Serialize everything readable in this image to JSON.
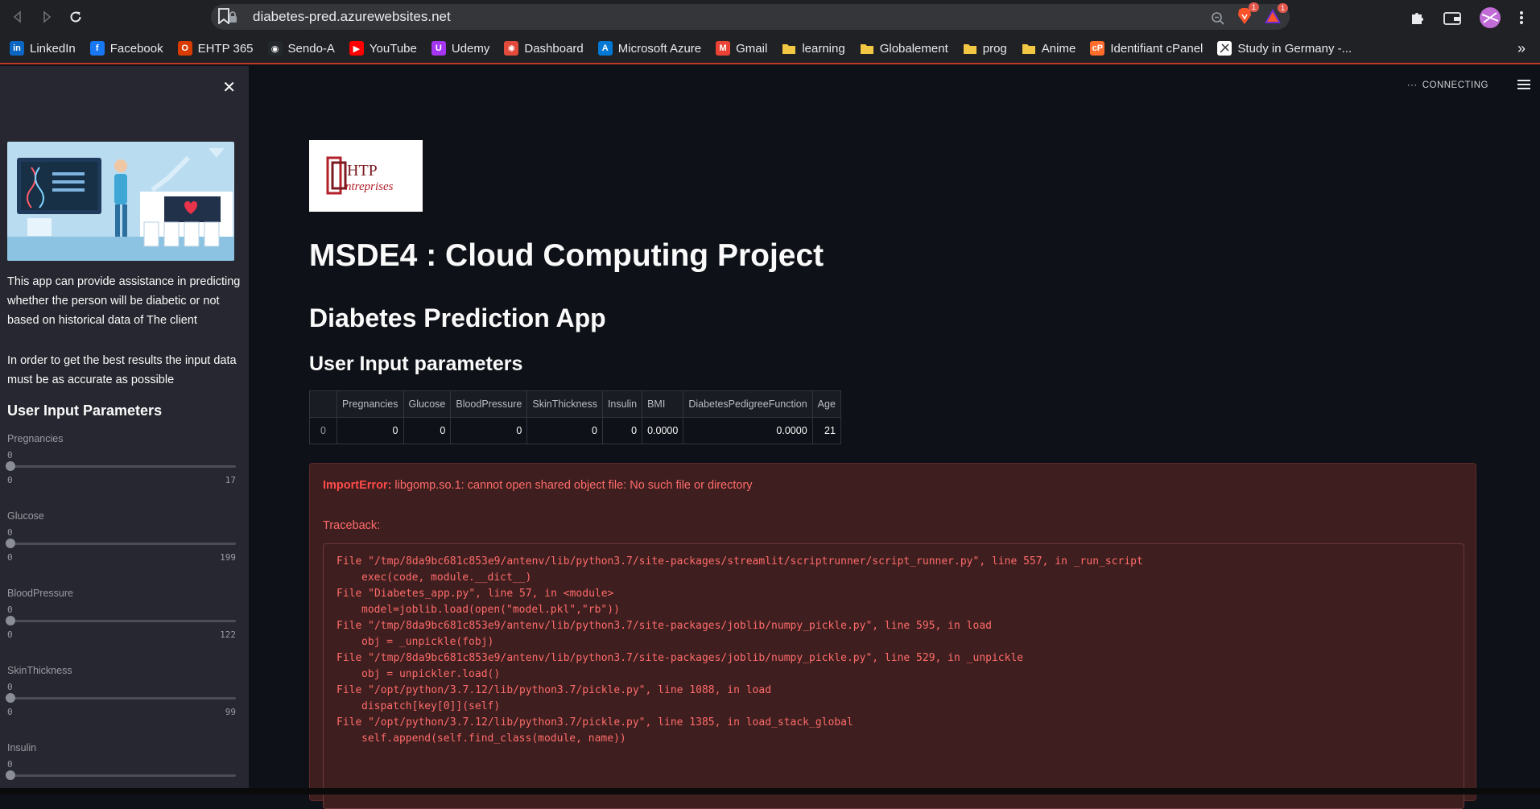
{
  "browser": {
    "url": "diabetes-pred.azurewebsites.net",
    "extension_badges": [
      "1",
      "1"
    ]
  },
  "bookmarks": [
    {
      "label": "LinkedIn",
      "icon": "linkedin-icon",
      "color": "#0a66c2",
      "glyph": "in"
    },
    {
      "label": "Facebook",
      "icon": "facebook-icon",
      "color": "#1877f2",
      "glyph": "f"
    },
    {
      "label": "EHTP 365",
      "icon": "office-icon",
      "color": "#d83b01",
      "glyph": "O"
    },
    {
      "label": "Sendo-A",
      "icon": "github-icon",
      "color": "#24292e",
      "glyph": "◉"
    },
    {
      "label": "YouTube",
      "icon": "youtube-icon",
      "color": "#ff0000",
      "glyph": "▶"
    },
    {
      "label": "Udemy",
      "icon": "udemy-icon",
      "color": "#a435f0",
      "glyph": "U"
    },
    {
      "label": "Dashboard",
      "icon": "dashboard-icon",
      "color": "#e24b3b",
      "glyph": "✺"
    },
    {
      "label": "Microsoft Azure",
      "icon": "azure-icon",
      "color": "#0078d4",
      "glyph": "A"
    },
    {
      "label": "Gmail",
      "icon": "gmail-icon",
      "color": "#ea4335",
      "glyph": "M"
    },
    {
      "label": "learning",
      "icon": "folder-icon",
      "color": "#f2c744",
      "glyph": ""
    },
    {
      "label": "Globalement",
      "icon": "folder-icon",
      "color": "#f2c744",
      "glyph": ""
    },
    {
      "label": "prog",
      "icon": "folder-icon",
      "color": "#f2c744",
      "glyph": ""
    },
    {
      "label": "Anime",
      "icon": "folder-icon",
      "color": "#f2c744",
      "glyph": ""
    },
    {
      "label": "Identifiant cPanel",
      "icon": "cpanel-icon",
      "color": "#ff6c2c",
      "glyph": "cP"
    },
    {
      "label": "Study in Germany -...",
      "icon": "study-icon",
      "color": "#ffffff",
      "glyph": ""
    }
  ],
  "sidebar": {
    "description_1": "This app can provide assistance in predicting whether the person will be diabetic or not based on historical data of The client",
    "description_2": "In order to get the best results the input data must be as accurate as possible",
    "heading": "User Input Parameters",
    "sliders": [
      {
        "label": "Pregnancies",
        "value": "0",
        "min": "0",
        "max": "17"
      },
      {
        "label": "Glucose",
        "value": "0",
        "min": "0",
        "max": "199"
      },
      {
        "label": "BloodPressure",
        "value": "0",
        "min": "0",
        "max": "122"
      },
      {
        "label": "SkinThickness",
        "value": "0",
        "min": "0",
        "max": "99"
      },
      {
        "label": "Insulin",
        "value": "0",
        "min": "",
        "max": ""
      }
    ]
  },
  "main": {
    "status": "CONNECTING",
    "logo_text_1": "HTP",
    "logo_text_2": "ntreprises",
    "title": "MSDE4 : Cloud Computing Project",
    "subtitle": "Diabetes Prediction App",
    "section": "User Input parameters",
    "table": {
      "columns": [
        "",
        "Pregnancies",
        "Glucose",
        "BloodPressure",
        "SkinThickness",
        "Insulin",
        "BMI",
        "DiabetesPedigreeFunction",
        "Age"
      ],
      "rows": [
        [
          "0",
          "0",
          "0",
          "0",
          "0",
          "0",
          "0.0000",
          "0.0000",
          "21"
        ]
      ]
    },
    "error": {
      "type": "ImportError:",
      "message": " libgomp.so.1: cannot open shared object file: No such file or directory",
      "traceback_label": "Traceback:",
      "frames": [
        {
          "file": "File \"/tmp/8da9bc681c853e9/antenv/lib/python3.7/site-packages/streamlit/scriptrunner/script_runner.py\", line 557, in _run_script",
          "code": "exec(code, module.__dict__)"
        },
        {
          "file": "File \"Diabetes_app.py\", line 57, in <module>",
          "code": "model=joblib.load(open(\"model.pkl\",\"rb\"))"
        },
        {
          "file": "File \"/tmp/8da9bc681c853e9/antenv/lib/python3.7/site-packages/joblib/numpy_pickle.py\", line 595, in load",
          "code": "obj = _unpickle(fobj)"
        },
        {
          "file": "File \"/tmp/8da9bc681c853e9/antenv/lib/python3.7/site-packages/joblib/numpy_pickle.py\", line 529, in _unpickle",
          "code": "obj = unpickler.load()"
        },
        {
          "file": "File \"/opt/python/3.7.12/lib/python3.7/pickle.py\", line 1088, in load",
          "code": "dispatch[key[0]](self)"
        },
        {
          "file": "File \"/opt/python/3.7.12/lib/python3.7/pickle.py\", line 1385, in load_stack_global",
          "code": "self.append(self.find_class(module, name))"
        }
      ]
    }
  }
}
